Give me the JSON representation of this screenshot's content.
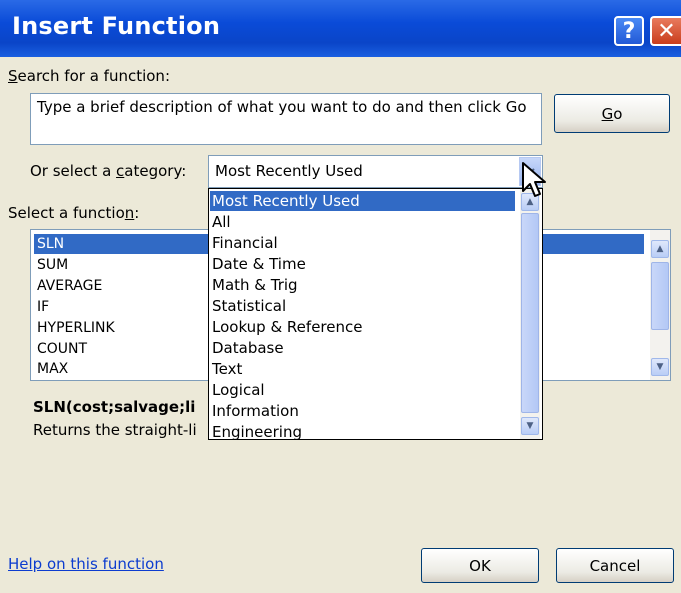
{
  "window": {
    "title": "Insert Function",
    "help_glyph": "?",
    "close_glyph": "✕"
  },
  "search": {
    "label_first": "S",
    "label_rest": "earch for a function:",
    "value": "Type a brief description of what you want to do and then click Go",
    "go_label_first": "G",
    "go_label_rest": "o"
  },
  "category": {
    "label_pre": "Or select a ",
    "label_key": "c",
    "label_post": "ategory:",
    "selected": "Most Recently Used",
    "options": [
      "Most Recently Used",
      "All",
      "Financial",
      "Date & Time",
      "Math & Trig",
      "Statistical",
      "Lookup & Reference",
      "Database",
      "Text",
      "Logical",
      "Information",
      "Engineering"
    ]
  },
  "functions": {
    "label_pre": "Select a functio",
    "label_key": "n",
    "label_post": ":",
    "items": [
      "SLN",
      "SUM",
      "AVERAGE",
      "IF",
      "HYPERLINK",
      "COUNT",
      "MAX"
    ],
    "selected": "SLN"
  },
  "details": {
    "syntax": "SLN(cost;salvage;li",
    "description": "Returns the straight-li"
  },
  "footer": {
    "help_link": "Help on this function",
    "ok_label": "OK",
    "cancel_label": "Cancel"
  },
  "colors": {
    "title_bar": "#0a4bd8",
    "dialog_bg": "#ece9d8",
    "selection": "#316ac5",
    "link": "#0c3ccf"
  },
  "icons": {
    "help": "question-mark-icon",
    "close": "close-icon",
    "combo_arrow": "chevron-down-icon",
    "cursor": "mouse-pointer-icon"
  }
}
